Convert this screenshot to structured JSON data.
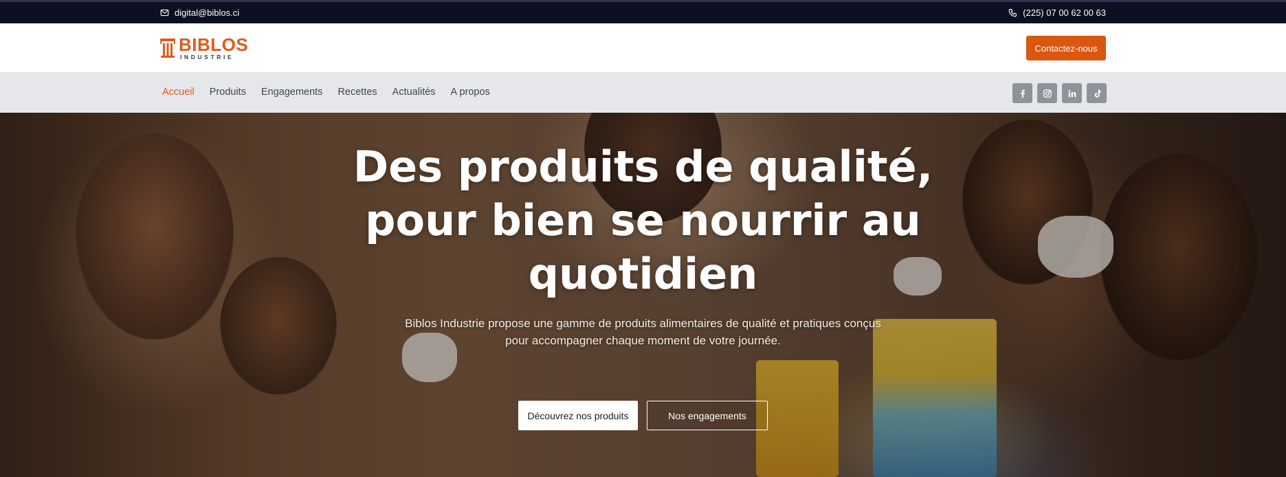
{
  "topbar": {
    "email": "digital@biblos.ci",
    "phone": "(225) 07 00 62 00 63"
  },
  "header": {
    "logo_main": "BIBLOS",
    "logo_sub": "INDUSTRIE",
    "cta_label": "Contactez-nous"
  },
  "nav": {
    "items": [
      {
        "label": "Accueil",
        "active": true
      },
      {
        "label": "Produits"
      },
      {
        "label": "Engagements"
      },
      {
        "label": "Recettes"
      },
      {
        "label": "Actualités"
      },
      {
        "label": "A propos"
      }
    ]
  },
  "social": [
    {
      "icon": "facebook-icon"
    },
    {
      "icon": "instagram-icon"
    },
    {
      "icon": "linkedin-icon"
    },
    {
      "icon": "tiktok-icon"
    }
  ],
  "hero": {
    "title": "Des produits de qualité, pour bien se nourrir au quotidien",
    "subtitle": "Biblos Industrie propose une gamme de produits alimentaires de qualité et pratiques conçus pour accompagner chaque moment de votre journée.",
    "primary_button": "Découvrez nos produits",
    "secondary_button": "Nos engagements"
  },
  "colors": {
    "accent": "#d9570f",
    "topbar_bg": "#0b0f1f",
    "nav_bg": "#e6e7ea",
    "social_bg": "#8e929a"
  }
}
